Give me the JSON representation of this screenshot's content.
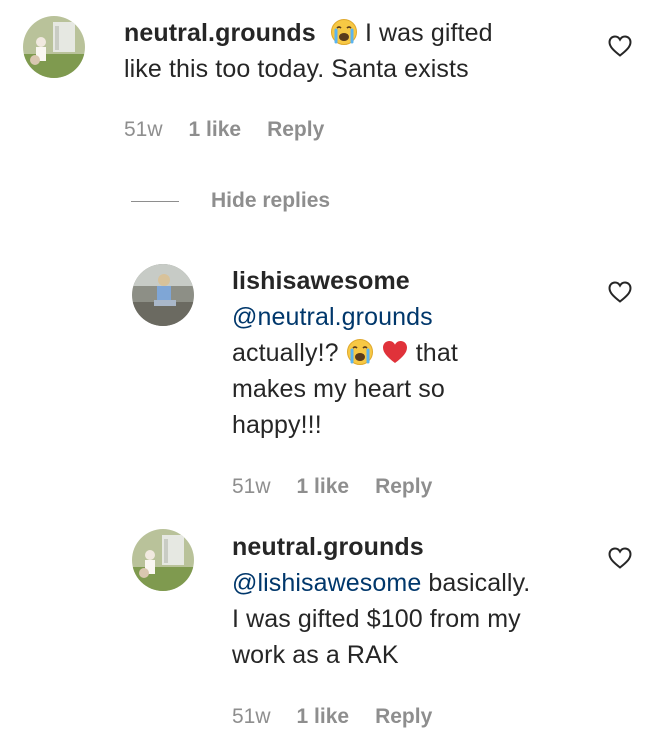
{
  "comments": [
    {
      "username": "neutral.grounds",
      "text_line1": "I was gifted",
      "text_line2": "like this too today. Santa exists",
      "time": "51w",
      "likes": "1 like",
      "reply": "Reply"
    },
    {
      "username": "lishisawesome",
      "mention": "@neutral.grounds",
      "line2_pre": "actually!?",
      "line2_post": "that",
      "line3": "makes my heart so",
      "line4": "happy!!!",
      "time": "51w",
      "likes": "1 like",
      "reply": "Reply"
    },
    {
      "username": "neutral.grounds",
      "mention": "@lishisawesome",
      "line1_post": "basically.",
      "line2": "I was gifted $100 from my",
      "line3": "work as a RAK",
      "time": "51w",
      "likes": "1 like",
      "reply": "Reply"
    }
  ],
  "hide_replies": "Hide replies"
}
